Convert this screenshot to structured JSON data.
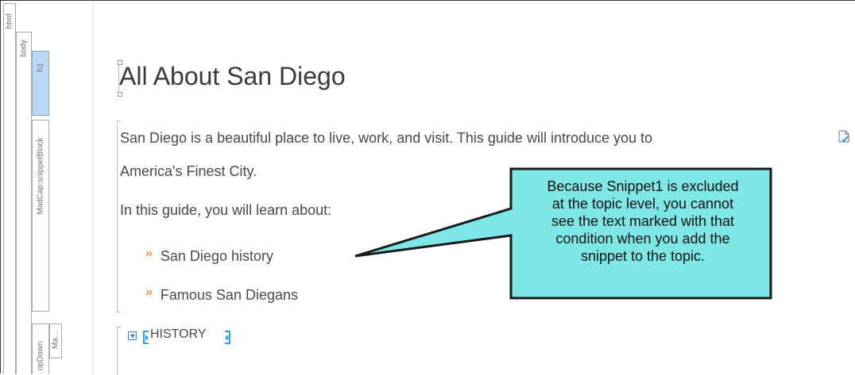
{
  "structure_bars": {
    "html": "html",
    "body": "body",
    "h1": "h1",
    "snippet_block": "MadCap:snippetBlock",
    "dropdown": "opDown",
    "ma": "Ma..."
  },
  "content": {
    "title": "All About San Diego",
    "paragraph1_line1": "San Diego is a beautiful place to live, work, and visit. This guide will introduce you to",
    "paragraph1_line2": "America's Finest City.",
    "paragraph2": "In this guide, you will learn about:",
    "bullet_glyph": "»",
    "list_items": [
      "San Diego history",
      "Famous San Diegans"
    ],
    "dropdown_heading": "HISTORY"
  },
  "callout": {
    "lines": [
      "Because Snippet1 is excluded",
      "at the topic level, you cannot",
      "see the text marked with that",
      "condition when you add the",
      "snippet to the topic."
    ],
    "fill_color": "#7fe6e6",
    "border_color": "#1a1a1a"
  },
  "colors": {
    "h1_bar": "#bcd7f3",
    "bullet": "#e8743b",
    "tag_marker": "#2f9ee6"
  }
}
